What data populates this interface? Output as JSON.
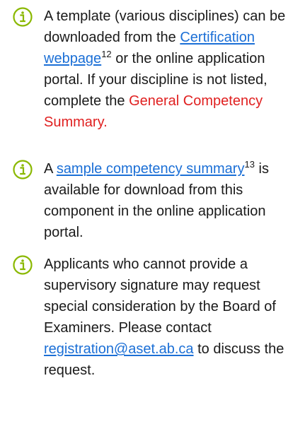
{
  "colors": {
    "icon": "#8ab800",
    "link": "#1b6fd6",
    "highlight": "#e02020",
    "text": "#1a1a1a"
  },
  "notes": [
    {
      "icon": "info-circle-icon",
      "text_before": "A template (various disciplines) can be downloaded from the",
      "link_text": "Certification webpage",
      "footnote": "12",
      "text_middle": "or the online application portal. If your discipline is not listed, complete the",
      "highlight_text": "General Competency Summary."
    },
    {
      "icon": "info-circle-icon",
      "text_before": "A",
      "link_text": "sample competency summary",
      "footnote": "13",
      "text_after": "is available for download from this component in the online application portal."
    },
    {
      "icon": "info-circle-icon",
      "text_before": "Applicants who cannot provide a supervisory signature may request special consideration by the Board of Examiners. Please contact",
      "link_text": "registration@aset.ab.ca",
      "text_after": "to discuss the request."
    }
  ]
}
